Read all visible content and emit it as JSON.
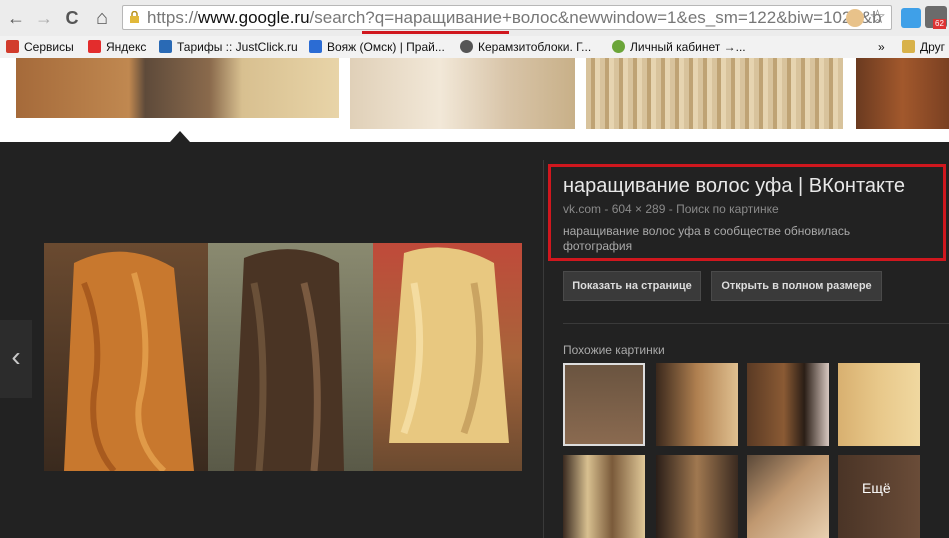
{
  "browser": {
    "nav": {
      "back": "←",
      "forward": "→",
      "reload": "C",
      "home": "⌂"
    },
    "url": {
      "scheme": "https://",
      "host": "www.google.ru",
      "path": "/search?q=наращивание+волос&newwindow=1&es_sm=122&biw=1024&b"
    },
    "extension_badge": "62"
  },
  "bookmarks": [
    {
      "label": "Сервисы",
      "color": "#d23c2c"
    },
    {
      "label": "Яндекс",
      "color": "#e32d2d"
    },
    {
      "label": "Тарифы :: JustClick.ru",
      "color": "#2a6ab5"
    },
    {
      "label": "Вояж (Омск) | Прай...",
      "color": "#2b6cd4"
    },
    {
      "label": "Керамзитоблоки. Г...",
      "color": "#555555"
    },
    {
      "label": "Личный кабинет →...",
      "color": "#6ba539"
    },
    {
      "label": "»",
      "color": ""
    },
    {
      "label": "Друг",
      "color": "#d8b24a"
    }
  ],
  "preview": {
    "title": "наращивание волос уфа | ВКонтакте",
    "source": "vk.com",
    "dimensions": "604 × 289",
    "reverse_search": "Поиск по картинке",
    "meta_separator": " - ",
    "description": "наращивание волос уфа в сообществе обновилась фотография",
    "buttons": {
      "visit": "Показать на странице",
      "full_size": "Открыть в полном размере"
    },
    "similar_title": "Похожие картинки",
    "more": "Ещё"
  },
  "colors": {
    "highlight": "#d0171e",
    "panel_bg": "#222222"
  }
}
